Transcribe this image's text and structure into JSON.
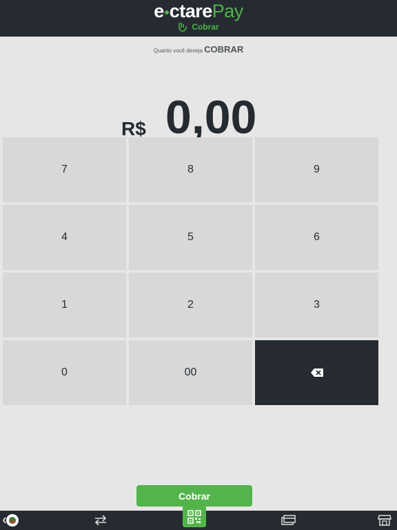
{
  "header": {
    "logo": {
      "part1": "e",
      "part2": "ctare",
      "part3": "Pay"
    },
    "nav_label": "Cobrar"
  },
  "prompt": {
    "text": "Quanto você deseja",
    "emphasis": "COBRAR"
  },
  "amount": {
    "currency": "R$",
    "value": "0,00"
  },
  "keypad": {
    "keys": [
      "7",
      "8",
      "9",
      "4",
      "5",
      "6",
      "1",
      "2",
      "3",
      "0",
      "00"
    ],
    "delete_icon": "backspace-icon"
  },
  "action_button": {
    "label": "Cobrar"
  },
  "bottom_nav": {
    "items": [
      {
        "icon": "back-avatar-icon"
      },
      {
        "icon": "transfer-icon"
      },
      {
        "icon": "qr-code-icon"
      },
      {
        "icon": "card-icon"
      },
      {
        "icon": "store-icon"
      }
    ]
  },
  "colors": {
    "brand_green": "#53b44b",
    "dark": "#252b30",
    "background": "#e6e6e6",
    "key": "#d8d8d8"
  }
}
